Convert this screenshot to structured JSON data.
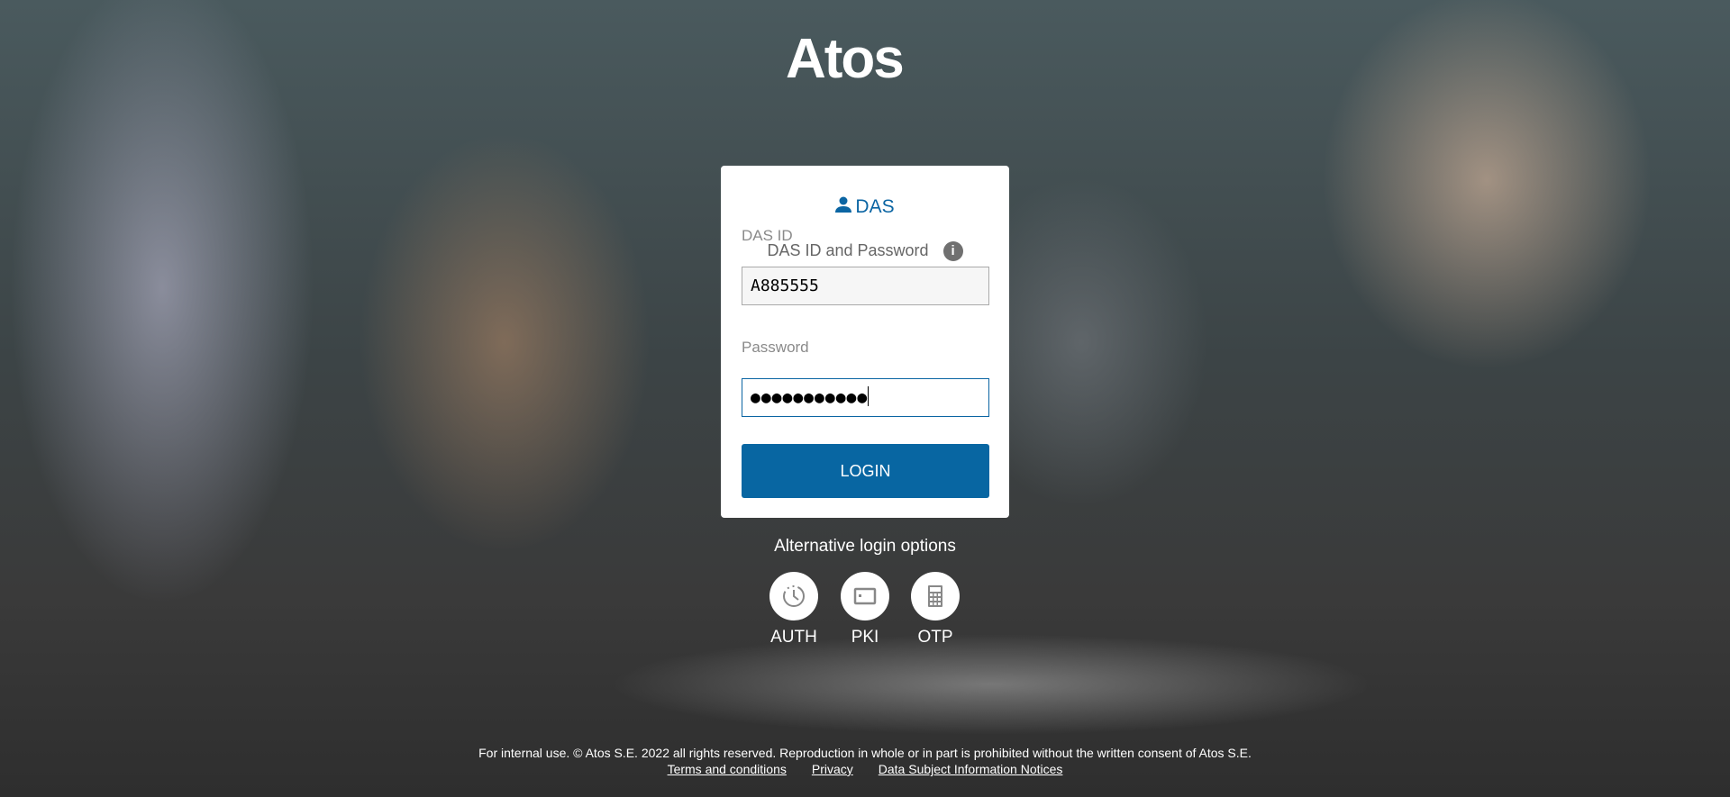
{
  "logo": {
    "text": "Atos"
  },
  "card": {
    "title": "DAS",
    "subtitle": "DAS ID and Password",
    "info_icon": "i",
    "das_id_label": "DAS ID",
    "das_id_value": "A885555",
    "password_label": "Password",
    "password_masked": "●●●●●●●●●●●",
    "login_label": "LOGIN",
    "accent": "#0866a2"
  },
  "alternative": {
    "heading": "Alternative login options",
    "options": [
      {
        "label": "AUTH",
        "icon": "clock-icon"
      },
      {
        "label": "PKI",
        "icon": "card-icon"
      },
      {
        "label": "OTP",
        "icon": "calculator-icon"
      }
    ]
  },
  "footer": {
    "notice": "For internal use. © Atos S.E. 2022 all rights reserved. Reproduction in whole or in part is prohibited without the written consent of Atos S.E.",
    "links": [
      "Terms and conditions",
      "Privacy",
      "Data Subject Information Notices"
    ]
  }
}
